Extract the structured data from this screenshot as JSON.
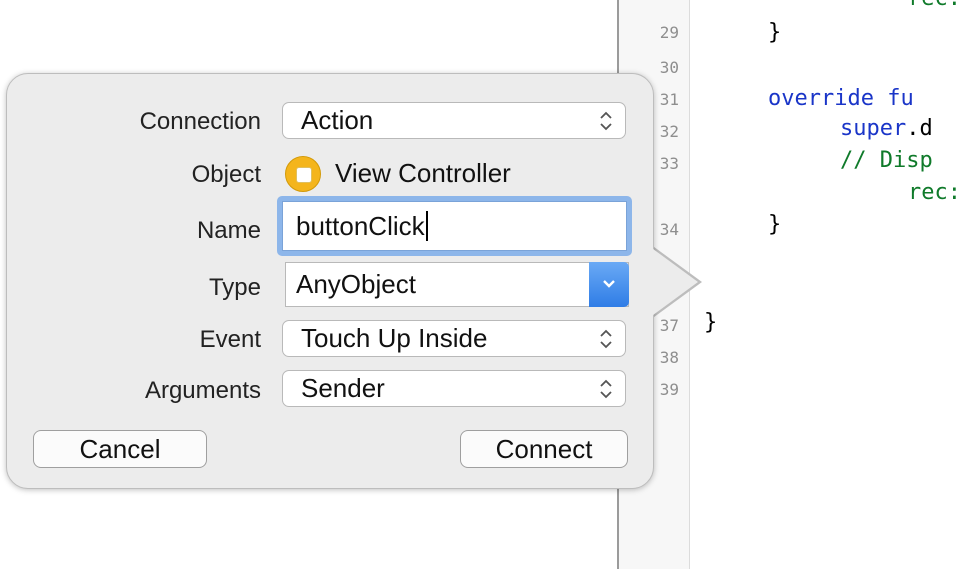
{
  "editor": {
    "line_numbers": [
      "29",
      "30",
      "31",
      "32",
      "33",
      "34",
      "37",
      "38",
      "39"
    ],
    "code": {
      "top_fragment": "rec:",
      "brace_29": "}",
      "override_kw": "override fu",
      "super_kw": "super",
      "super_rest": ".d",
      "comment": "// Disp",
      "comment_cont": "rec:",
      "brace_34": "}",
      "brace_37": "}"
    }
  },
  "popover": {
    "connection": {
      "label": "Connection",
      "value": "Action"
    },
    "object": {
      "label": "Object",
      "value": "View Controller"
    },
    "name": {
      "label": "Name",
      "value": "buttonClick"
    },
    "type": {
      "label": "Type",
      "value": "AnyObject"
    },
    "event": {
      "label": "Event",
      "value": "Touch Up Inside"
    },
    "arguments": {
      "label": "Arguments",
      "value": "Sender"
    },
    "cancel_label": "Cancel",
    "connect_label": "Connect"
  },
  "colors": {
    "keyword": "#1a35c8",
    "comment": "#0f7a2a",
    "focus_ring": "#8db6ea",
    "object_icon": "#f4b51c"
  }
}
